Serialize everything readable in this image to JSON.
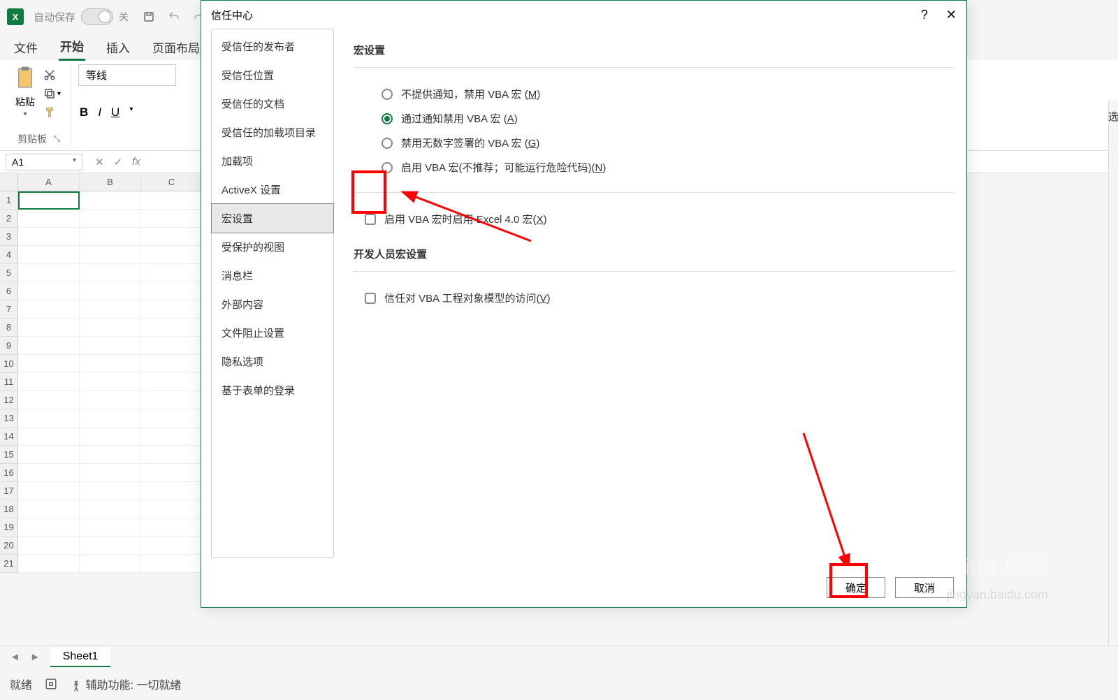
{
  "titlebar": {
    "autosave_label": "自动保存",
    "toggle_off": "关"
  },
  "ribbon": {
    "tabs": [
      "文件",
      "开始",
      "插入",
      "页面布局"
    ],
    "active_index": 1,
    "paste_label": "粘贴",
    "clipboard_group": "剪贴板",
    "font_name": "等线",
    "bold": "B",
    "italic": "I",
    "underline_btn": "U"
  },
  "formula_bar": {
    "name_box": "A1",
    "fx": "fx"
  },
  "sheet": {
    "tab_name": "Sheet1"
  },
  "status": {
    "ready": "就绪",
    "acc": "辅助功能: 一切就绪"
  },
  "dialog": {
    "title": "信任中心",
    "help": "?",
    "close": "✕",
    "sidebar": [
      "受信任的发布者",
      "受信任位置",
      "受信任的文档",
      "受信任的加载项目录",
      "加载项",
      "ActiveX 设置",
      "宏设置",
      "受保护的视图",
      "消息栏",
      "外部内容",
      "文件阻止设置",
      "隐私选项",
      "基于表单的登录"
    ],
    "selected_index": 6,
    "section_macro": "宏设置",
    "radios": [
      {
        "pre": "不提供通知，禁用 VBA 宏 (",
        "u": "M",
        "post": ")"
      },
      {
        "pre": "通过通知禁用 VBA 宏 (",
        "u": "A",
        "post": ")"
      },
      {
        "pre": "禁用无数字签署的 VBA 宏 (",
        "u": "G",
        "post": ")"
      },
      {
        "pre": "启用 VBA 宏(不推荐；可能运行危险代码)(",
        "u": "N",
        "post": ")"
      }
    ],
    "radio_checked": 1,
    "check1": {
      "pre": "启用 VBA 宏时启用 Excel 4.0 宏(",
      "u": "X",
      "post": ")"
    },
    "section_dev": "开发人员宏设置",
    "check2": {
      "pre": "信任对 VBA 工程对象模型的访问(",
      "u": "V",
      "post": ")"
    },
    "ok": "确定",
    "cancel": "取消"
  },
  "right_cut": "选",
  "watermark": "Baidu 经验",
  "watermark2": "jingyan.baidu.com"
}
